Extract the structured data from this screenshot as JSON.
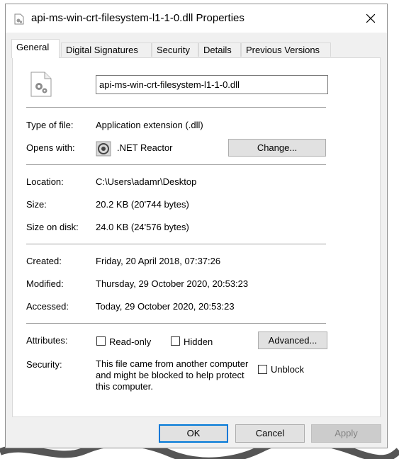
{
  "window": {
    "title": "api-ms-win-crt-filesystem-l1-1-0.dll Properties",
    "close_icon": "close-icon"
  },
  "tabs": [
    {
      "label": "General",
      "active": true
    },
    {
      "label": "Digital Signatures",
      "active": false
    },
    {
      "label": "Security",
      "active": false
    },
    {
      "label": "Details",
      "active": false
    },
    {
      "label": "Previous Versions",
      "active": false
    }
  ],
  "general": {
    "file_name": "api-ms-win-crt-filesystem-l1-1-0.dll",
    "type_label": "Type of file:",
    "type_value": "Application extension (.dll)",
    "opens_label": "Opens with:",
    "opens_value": ".NET Reactor",
    "change_button": "Change...",
    "location_label": "Location:",
    "location_value": "C:\\Users\\adamr\\Desktop",
    "size_label": "Size:",
    "size_value": "20.2 KB (20'744 bytes)",
    "size_disk_label": "Size on disk:",
    "size_disk_value": "24.0 KB (24'576 bytes)",
    "created_label": "Created:",
    "created_value": "Friday, 20 April 2018, 07:37:26",
    "modified_label": "Modified:",
    "modified_value": "Thursday, 29 October 2020, 20:53:23",
    "accessed_label": "Accessed:",
    "accessed_value": "Today, 29 October 2020, 20:53:23",
    "attributes_label": "Attributes:",
    "readonly_label": "Read-only",
    "readonly_checked": false,
    "hidden_label": "Hidden",
    "hidden_checked": false,
    "advanced_button": "Advanced...",
    "security_label": "Security:",
    "security_text": "This file came from another computer and might be blocked to help protect this computer.",
    "unblock_label": "Unblock",
    "unblock_checked": false
  },
  "footer": {
    "ok": "OK",
    "cancel": "Cancel",
    "apply": "Apply"
  },
  "colors": {
    "focus_blue": "#0078d7",
    "panel_bg": "#ffffff",
    "window_bg": "#f0f0f0"
  }
}
